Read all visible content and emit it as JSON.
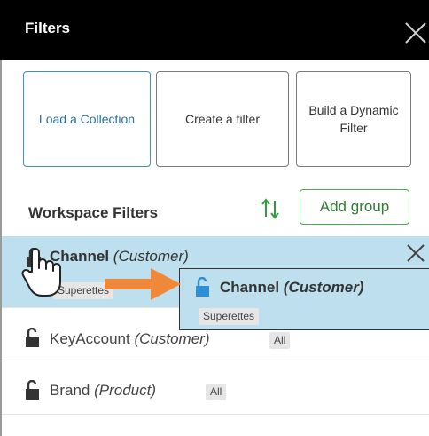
{
  "panel": {
    "title": "Filters",
    "close_icon": "close-icon"
  },
  "actions": {
    "load_collection": "Load a Collection",
    "create_filter": "Create a filter",
    "build_dynamic": "Build a Dynamic Filter"
  },
  "workspace": {
    "title": "Workspace Filters",
    "add_group": "Add group",
    "sort_icon": "sort-icon"
  },
  "filters": [
    {
      "name": "Channel",
      "entity": "(Customer)",
      "badge": "Superettes",
      "selected": true
    },
    {
      "name": "KeyAccount",
      "entity": "(Customer)",
      "badge": "All",
      "selected": false
    },
    {
      "name": "Brand",
      "entity": "(Product)",
      "badge": "All",
      "selected": false
    }
  ],
  "drag_preview": {
    "name": "Channel",
    "entity": "(Customer)",
    "badge": "Superettes"
  },
  "colors": {
    "header_bg": "#000000",
    "selected_row": "#bee0ee",
    "accent_blue": "#2f8fd6",
    "add_group_green": "#4caf50",
    "arrow_orange": "#f0883a"
  }
}
